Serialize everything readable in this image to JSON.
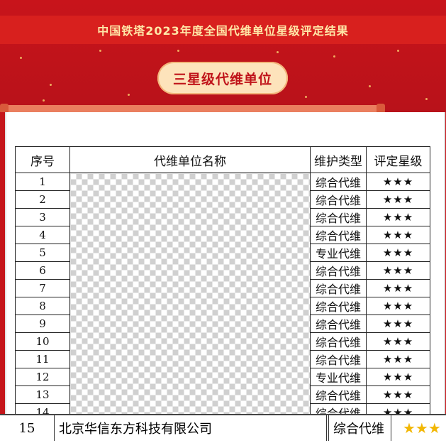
{
  "banner": {
    "title": "中国铁塔2023年度全国代维单位星级评定结果",
    "pill_label": "三星级代维单位"
  },
  "table": {
    "headers": [
      "序号",
      "代维单位名称",
      "维护类型",
      "评定星级"
    ],
    "rows": [
      {
        "no": "1",
        "type": "综合代维",
        "stars": "★★★"
      },
      {
        "no": "2",
        "type": "综合代维",
        "stars": "★★★"
      },
      {
        "no": "3",
        "type": "综合代维",
        "stars": "★★★"
      },
      {
        "no": "4",
        "type": "综合代维",
        "stars": "★★★"
      },
      {
        "no": "5",
        "type": "专业代维",
        "stars": "★★★"
      },
      {
        "no": "6",
        "type": "综合代维",
        "stars": "★★★"
      },
      {
        "no": "7",
        "type": "综合代维",
        "stars": "★★★"
      },
      {
        "no": "8",
        "type": "综合代维",
        "stars": "★★★"
      },
      {
        "no": "9",
        "type": "综合代维",
        "stars": "★★★"
      },
      {
        "no": "10",
        "type": "综合代维",
        "stars": "★★★"
      },
      {
        "no": "11",
        "type": "综合代维",
        "stars": "★★★"
      },
      {
        "no": "12",
        "type": "专业代维",
        "stars": "★★★"
      },
      {
        "no": "13",
        "type": "综合代维",
        "stars": "★★★"
      },
      {
        "no": "14",
        "type": "综合代维",
        "stars": "★★★"
      }
    ]
  },
  "highlight_row": {
    "no": "15",
    "name": "北京华信东方科技有限公司",
    "type": "综合代维",
    "stars": "★★★"
  },
  "colors": {
    "banner_red": "#c8141b",
    "title_text": "#ffe8a8",
    "pill_bg": "#fde3bb",
    "pill_text": "#c0141a",
    "star": "#f2b705"
  }
}
